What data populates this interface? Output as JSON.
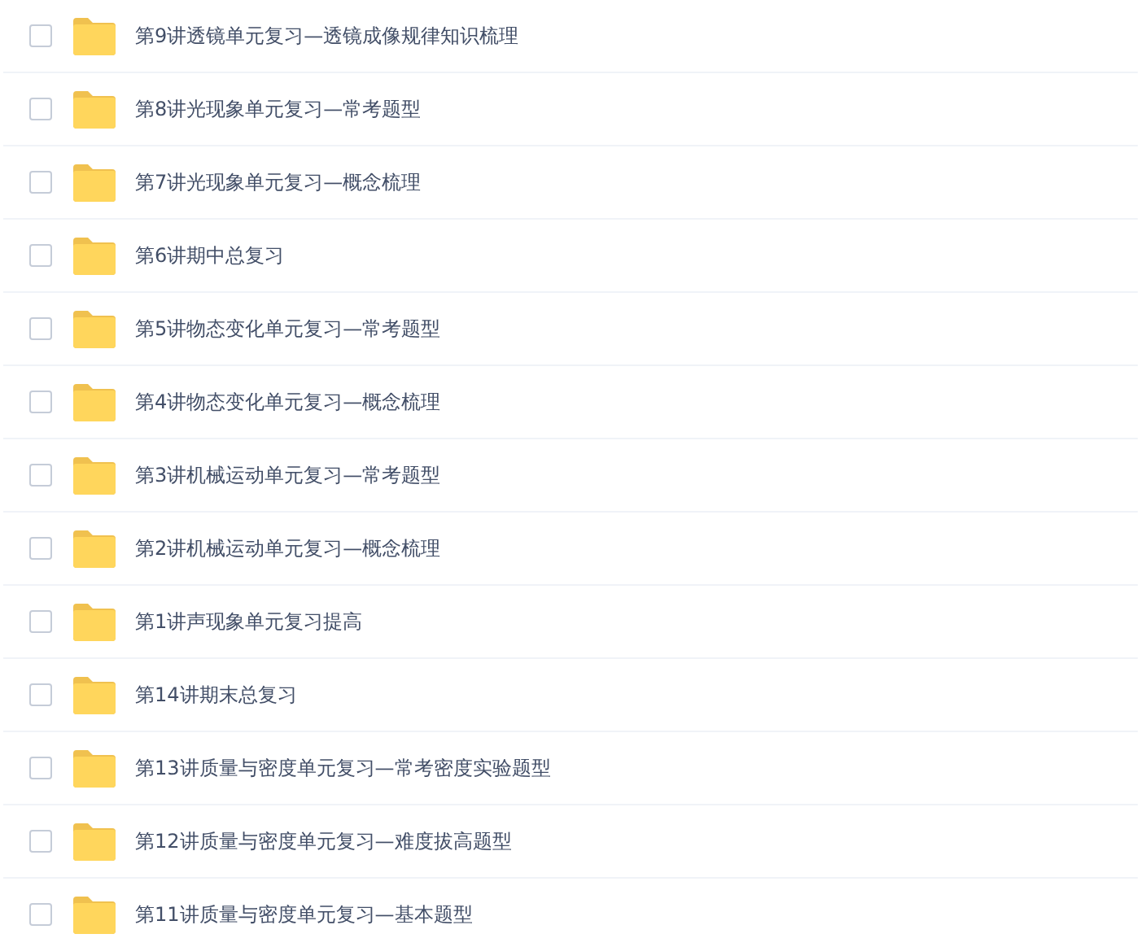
{
  "files": [
    {
      "name": "第9讲透镜单元复习—透镜成像规律知识梳理",
      "checked": false
    },
    {
      "name": "第8讲光现象单元复习—常考题型",
      "checked": false
    },
    {
      "name": "第7讲光现象单元复习—概念梳理",
      "checked": false
    },
    {
      "name": "第6讲期中总复习",
      "checked": false
    },
    {
      "name": "第5讲物态变化单元复习—常考题型",
      "checked": false
    },
    {
      "name": "第4讲物态变化单元复习—概念梳理",
      "checked": false
    },
    {
      "name": "第3讲机械运动单元复习—常考题型",
      "checked": false
    },
    {
      "name": "第2讲机械运动单元复习—概念梳理",
      "checked": false
    },
    {
      "name": "第1讲声现象单元复习提高",
      "checked": false
    },
    {
      "name": "第14讲期末总复习",
      "checked": false
    },
    {
      "name": "第13讲质量与密度单元复习—常考密度实验题型",
      "checked": false
    },
    {
      "name": "第12讲质量与密度单元复习—难度拔高题型",
      "checked": false
    },
    {
      "name": "第11讲质量与密度单元复习—基本题型",
      "checked": false
    }
  ]
}
